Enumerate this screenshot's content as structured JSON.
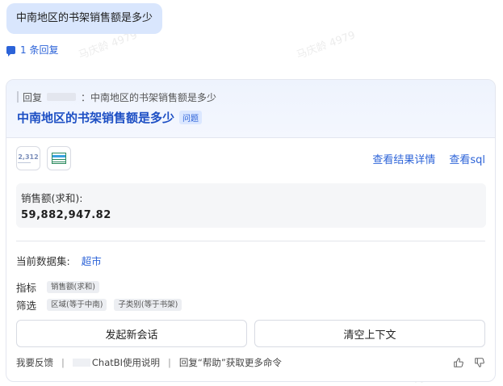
{
  "user_message": "中南地区的书架销售额是多少",
  "reply_count_label": "1 条回复",
  "card": {
    "reply_prefix": "回复",
    "reply_to_text": "：中南地区的书架销售额是多少",
    "title": "中南地区的书架销售额是多少",
    "title_tag": "问题",
    "toolbar": {
      "number_icon_text": "2,312",
      "view_details_label": "查看结果详情",
      "view_sql_label": "查看sql"
    },
    "result": {
      "label": "销售额(求和):",
      "value": "59,882,947.82"
    },
    "dataset": {
      "label": "当前数据集:",
      "name": "超市"
    },
    "metrics": {
      "label": "指标",
      "chips": [
        "销售额(求和)"
      ]
    },
    "filter": {
      "label": "筛选",
      "chips": [
        "区域(等于中南)",
        "子类别(等于书架)"
      ]
    },
    "buttons": {
      "new_session": "发起新会话",
      "clear_context": "清空上下文"
    },
    "footer": {
      "feedback": "我要反馈",
      "guide": "ChatBI使用说明",
      "help": "回复“帮助”获取更多命令"
    }
  },
  "watermark_text": "马庆龄 4979",
  "colors": {
    "accent": "#2c63d8",
    "bubble": "#d9e6fd",
    "title": "#1d4fc4"
  }
}
